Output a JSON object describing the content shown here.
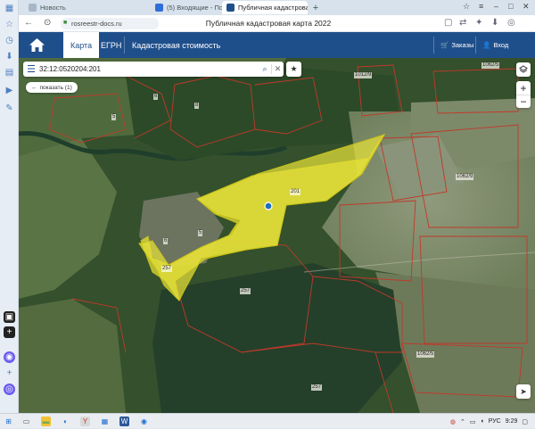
{
  "browser": {
    "tabs": [
      {
        "label": "Новость",
        "icon": "globe-icon"
      },
      {
        "label": "(5) Входящие - Почта Mail",
        "icon": "mail-icon"
      },
      {
        "label": "Публичная кадастровая",
        "icon": "map-icon"
      }
    ],
    "new_tab_label": "+",
    "url": "rosreestr-docs.ru",
    "page_title": "Публичная кадастровая карта 2022"
  },
  "site": {
    "tabs": [
      {
        "label": "Карта"
      },
      {
        "label": "ЕГРН"
      },
      {
        "label": "Кадастровая стоимость"
      }
    ],
    "orders_label": "Заказы",
    "login_label": "Вход"
  },
  "map": {
    "search_value": "32:12:0520204:201",
    "show_button_label": "показать (1)",
    "zoom_in_label": "+",
    "zoom_out_label": "−",
    "plot_labels": [
      {
        "text": "201"
      },
      {
        "text": "257"
      },
      {
        "text": "257"
      },
      {
        "text": "257"
      },
      {
        "text": "6"
      },
      {
        "text": "5"
      },
      {
        "text": "6"
      },
      {
        "text": "8"
      },
      {
        "text": "5"
      },
      {
        "text": "1012/9"
      },
      {
        "text": "1062/5"
      },
      {
        "text": "1062/5"
      },
      {
        "text": "1062/9"
      }
    ],
    "colors": {
      "selected_plot": "#e6e239",
      "boundary": "#c0392b",
      "header": "#1f4f8b"
    }
  },
  "taskbar": {
    "language": "РУС",
    "time": "9:29"
  }
}
